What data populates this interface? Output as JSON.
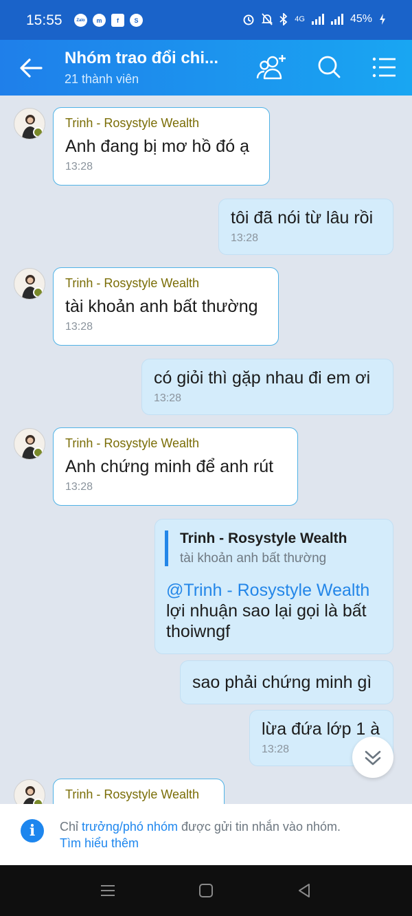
{
  "status_bar": {
    "time": "15:55",
    "apps": [
      "Zalo",
      "messenger-icon",
      "facebook-icon",
      "skype-icon"
    ],
    "network": "4G",
    "battery": "45%"
  },
  "header": {
    "title": "Nhóm trao đổi chi...",
    "subtitle": "21 thành viên"
  },
  "messages": [
    {
      "sender": "Trinh - Rosystyle Wealth",
      "text": "Anh đang bị mơ hồ đó ạ",
      "time": "13:28"
    },
    {
      "text": "tôi đã nói từ lâu rồi",
      "time": "13:28"
    },
    {
      "sender": "Trinh - Rosystyle Wealth",
      "text": "tài khoản anh bất thường",
      "time": "13:28"
    },
    {
      "text": "có giỏi thì gặp nhau đi em ơi",
      "time": "13:28"
    },
    {
      "sender": "Trinh - Rosystyle Wealth",
      "text": "Anh chứng minh để anh rút",
      "time": "13:28"
    },
    {
      "quote_name": "Trinh - Rosystyle Wealth",
      "quote_text": "tài khoản anh bất thường",
      "mention": "@Trinh - Rosystyle Wealth",
      "text_line1": "lợi nhuận sao lại gọi là bất",
      "text_line2": "thoiwngf"
    },
    {
      "text": "sao phải chứng minh gì"
    },
    {
      "text": "lừa đứa lớp 1 à",
      "time": "13:28"
    },
    {
      "sender": "Trinh - Rosystyle Wealth"
    }
  ],
  "info_bar": {
    "prefix": "Chỉ ",
    "link": "trưởng/phó nhóm",
    "suffix": " được gửi tin nhắn vào nhóm.",
    "learn_more": "Tìm hiểu thêm"
  },
  "colors": {
    "header": "#1f7fea",
    "status_bar": "#1a63c9",
    "incoming_border": "#4fb2e6",
    "outgoing_bg": "#d4ecfb",
    "sender_name": "#7a6d06",
    "link": "#1d86ee"
  }
}
